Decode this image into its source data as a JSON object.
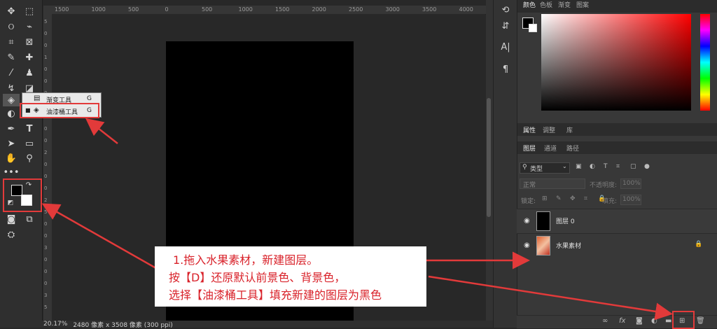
{
  "ruler_top": [
    "1500",
    "1000",
    "500",
    "0",
    "500",
    "1000",
    "1500",
    "2000",
    "2500",
    "3000",
    "3500",
    "4000"
  ],
  "ruler_left": [
    "5",
    "0",
    "0",
    "1",
    "0",
    "0",
    "0",
    "1",
    "5",
    "0",
    "0",
    "2",
    "0",
    "0",
    "0",
    "2",
    "5",
    "0",
    "0",
    "3",
    "0",
    "0",
    "0",
    "3",
    "5"
  ],
  "status": {
    "zoom": "20.17%",
    "info": "2480 像素 x 3508 像素 (300 ppi)"
  },
  "flyout": {
    "items": [
      {
        "label": "渐变工具",
        "key": "G"
      },
      {
        "label": "油漆桶工具",
        "key": "G"
      }
    ]
  },
  "color_panel": {
    "tabs": [
      "颜色",
      "色板",
      "渐变",
      "图案"
    ]
  },
  "props_panel": {
    "tabs": [
      "属性",
      "调整",
      "库"
    ]
  },
  "layers_panel": {
    "tabs": [
      "图层",
      "通道",
      "路径"
    ],
    "filter_label": "类型",
    "blend_mode": "正常",
    "opacity_label": "不透明度:",
    "opacity_value": "100%",
    "lock_label": "锁定:",
    "fill_label": "填充:",
    "fill_value": "100%",
    "layers": [
      {
        "name": "图层 0"
      },
      {
        "name": "水果素材"
      }
    ]
  },
  "annotation": {
    "lines": [
      "1.拖入水果素材，新建图层。",
      "按【D】还原默认前景色、背景色，",
      "选择【油漆桶工具】填充新建的图层为黑色"
    ]
  },
  "colors": {
    "accent_red": "#e23a3a",
    "fg_swatch": "#000000",
    "bg_swatch": "#ffffff"
  }
}
